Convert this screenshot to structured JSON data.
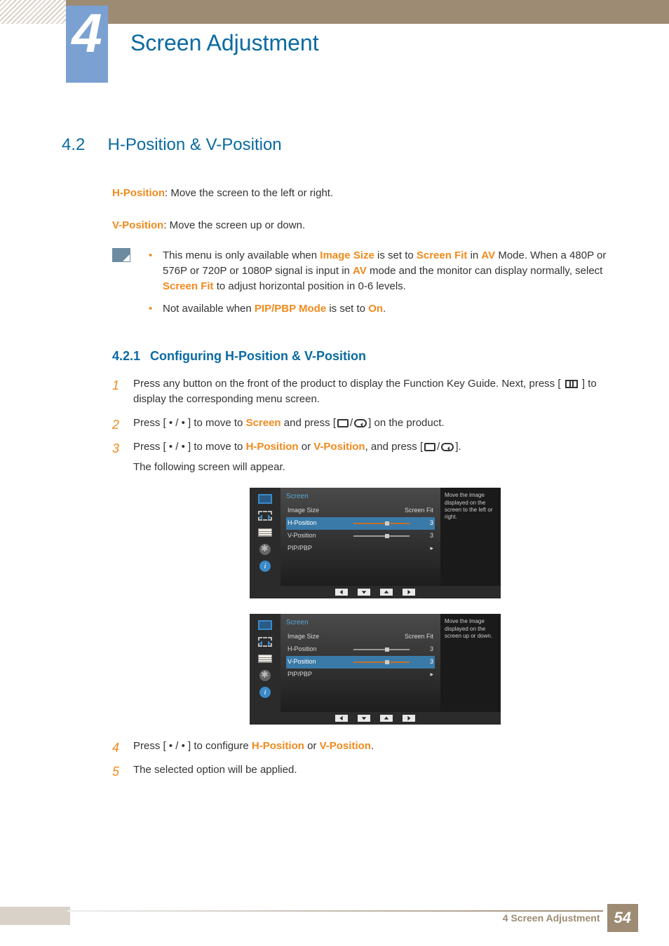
{
  "chapter": {
    "number": "4",
    "title": "Screen Adjustment"
  },
  "section": {
    "number": "4.2",
    "title": "H-Position & V-Position"
  },
  "def": {
    "h_label": "H-Position",
    "h_text": ": Move the screen to the left or right.",
    "v_label": "V-Position",
    "v_text": ": Move the screen up or down."
  },
  "notes": {
    "n1a": "This menu is only available when ",
    "n1b": "Image Size",
    "n1c": " is set to ",
    "n1d": "Screen Fit",
    "n1e": " in ",
    "n1f": "AV",
    "n1g": " Mode. When a 480P or 576P or 720P or 1080P signal is input in ",
    "n1h": "AV",
    "n1i": " mode and the monitor can display normally, select ",
    "n1j": "Screen Fit",
    "n1k": " to adjust horizontal position in 0-6 levels.",
    "n2a": "Not available when ",
    "n2b": "PIP/PBP Mode",
    "n2c": " is set to ",
    "n2d": "On",
    "n2e": "."
  },
  "subsec": {
    "number": "4.2.1",
    "title": "Configuring H-Position & V-Position"
  },
  "steps": {
    "s1": "Press any button on the front of the product to display the Function Key Guide. Next, press [ ",
    "s1b": " ] to display the corresponding menu screen.",
    "s2a": "Press [ • / • ] to move to ",
    "s2b": "Screen",
    "s2c": " and press [",
    "s2d": "] on the product.",
    "s3a": "Press [ • / • ] to move to ",
    "s3b": "H-Position",
    "s3c": " or ",
    "s3d": "V-Position",
    "s3e": ", and press [",
    "s3f": "].",
    "s3g": "The following screen will appear.",
    "s4a": "Press [ • / • ] to configure ",
    "s4b": "H-Position",
    "s4c": " or ",
    "s4d": "V-Position",
    "s4e": ".",
    "s5": "The selected option will be applied."
  },
  "osd": {
    "header": "Screen",
    "rows": {
      "imgsize": "Image Size",
      "imgsize_val": "Screen Fit",
      "hpos": "H-Position",
      "hpos_val": "3",
      "vpos": "V-Position",
      "vpos_val": "3",
      "pip": "PIP/PBP",
      "pip_val": "▸"
    },
    "desc1": "Move the image displayed on the screen to the left or right.",
    "desc2": "Move the image displayed on the screen up or down.",
    "info_glyph": "i"
  },
  "footer": {
    "text": "4 Screen Adjustment",
    "page": "54"
  }
}
